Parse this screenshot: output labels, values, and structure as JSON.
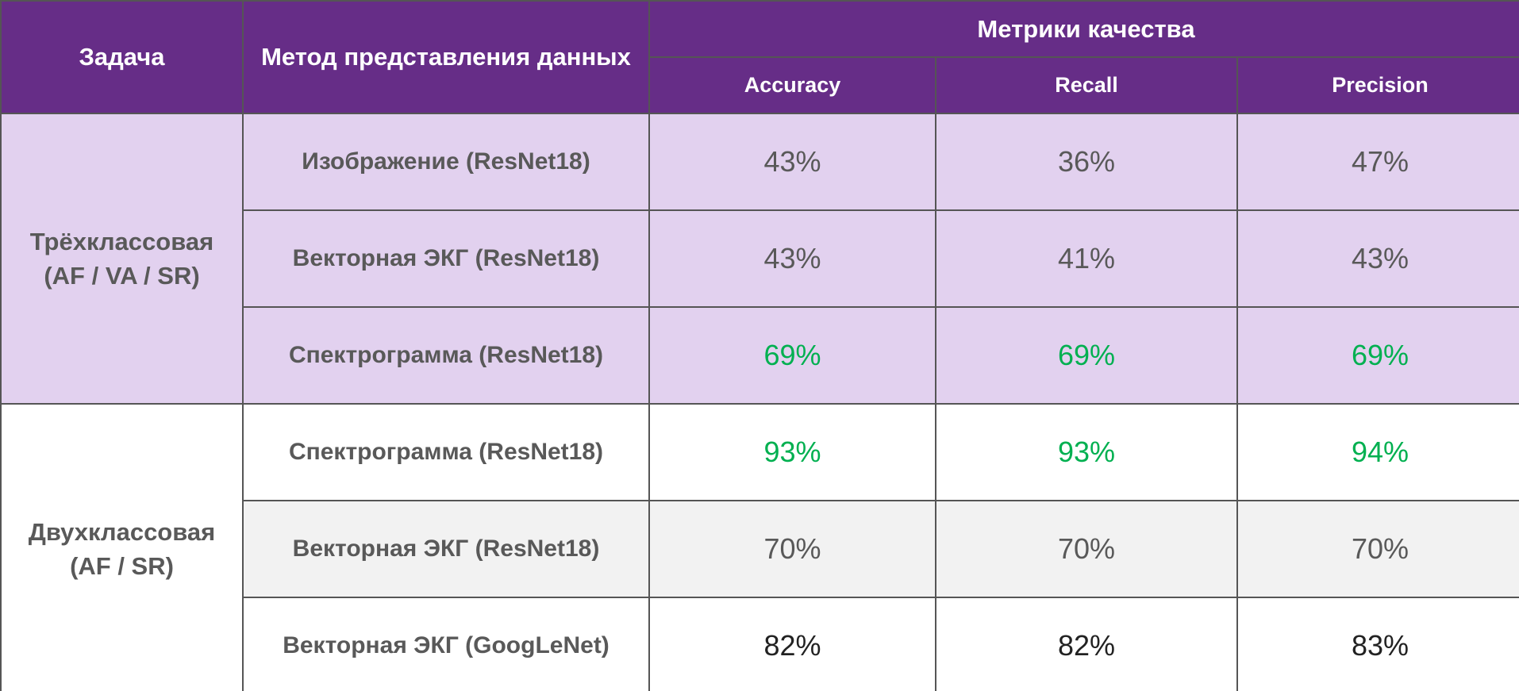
{
  "header": {
    "task": "Задача",
    "method": "Метод представления данных",
    "metrics": "Метрики качества",
    "accuracy": "Accuracy",
    "recall": "Recall",
    "precision": "Precision"
  },
  "groups": [
    {
      "task_line1": "Трёхклассовая",
      "task_line2": "(AF / VA / SR)",
      "rows": [
        {
          "method": "Изображение (ResNet18)",
          "accuracy": "43%",
          "recall": "36%",
          "precision": "47%"
        },
        {
          "method": "Векторная ЭКГ (ResNet18)",
          "accuracy": "43%",
          "recall": "41%",
          "precision": "43%"
        },
        {
          "method": "Спектрограмма (ResNet18)",
          "accuracy": "69%",
          "recall": "69%",
          "precision": "69%"
        }
      ]
    },
    {
      "task_line1": "Двухклассовая",
      "task_line2": "(AF / SR)",
      "rows": [
        {
          "method": "Спектрограмма (ResNet18)",
          "accuracy": "93%",
          "recall": "93%",
          "precision": "94%"
        },
        {
          "method": "Векторная ЭКГ (ResNet18)",
          "accuracy": "70%",
          "recall": "70%",
          "precision": "70%"
        },
        {
          "method": "Векторная ЭКГ (GoogLeNet)",
          "accuracy": "82%",
          "recall": "82%",
          "precision": "83%"
        }
      ]
    }
  ],
  "colors": {
    "header_bg": "#662d87",
    "purple_row_bg": "#e2d1ef",
    "gray_row_bg": "#f2f2f2",
    "highlight_green": "#00b050",
    "text_gray": "#595959",
    "border": "#555555"
  }
}
